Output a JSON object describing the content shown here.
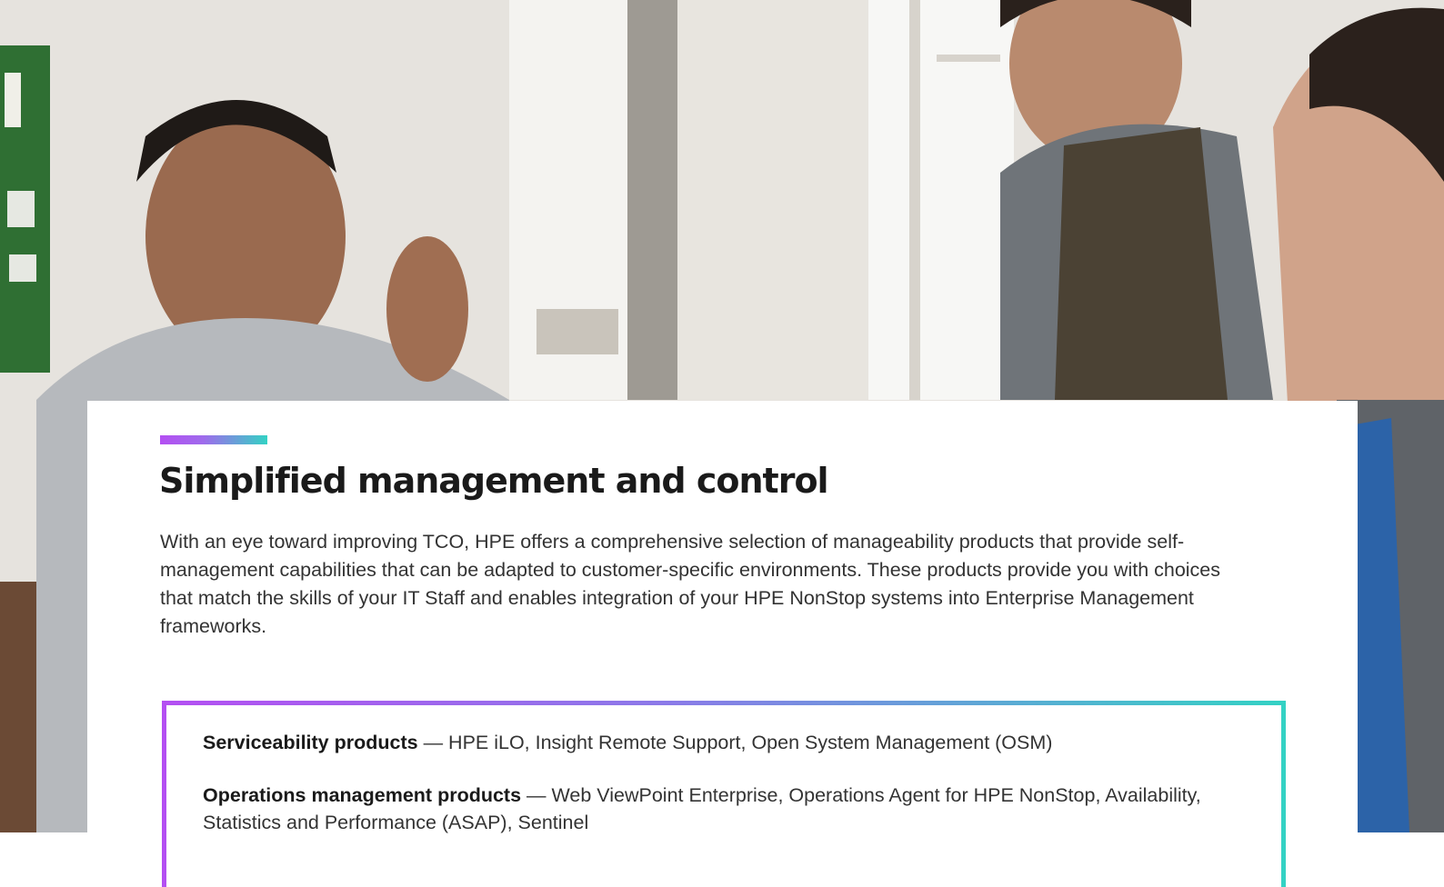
{
  "section": {
    "title": "Simplified management and control",
    "body": "With an eye toward improving TCO, HPE offers a comprehensive selection of manageability products that provide self-management capabilities that can be adapted to customer-specific environments. These products provide you with choices that match the skills of your IT Staff and enables integration of your HPE NonStop systems into Enterprise Management frameworks."
  },
  "products": [
    {
      "name": "Serviceability products",
      "separator": " — ",
      "description": "HPE iLO, Insight Remote Support, Open System Management (OSM)"
    },
    {
      "name": "Operations management products",
      "separator": " — ",
      "description": "Web ViewPoint Enterprise, Operations Agent for HPE NonStop, Availability, Statistics and Performance (ASAP), Sentinel"
    }
  ],
  "colors": {
    "accent_start": "#b44ff2",
    "accent_end": "#33d2c4",
    "title_text": "#1a1a1a",
    "body_text": "#333333"
  }
}
